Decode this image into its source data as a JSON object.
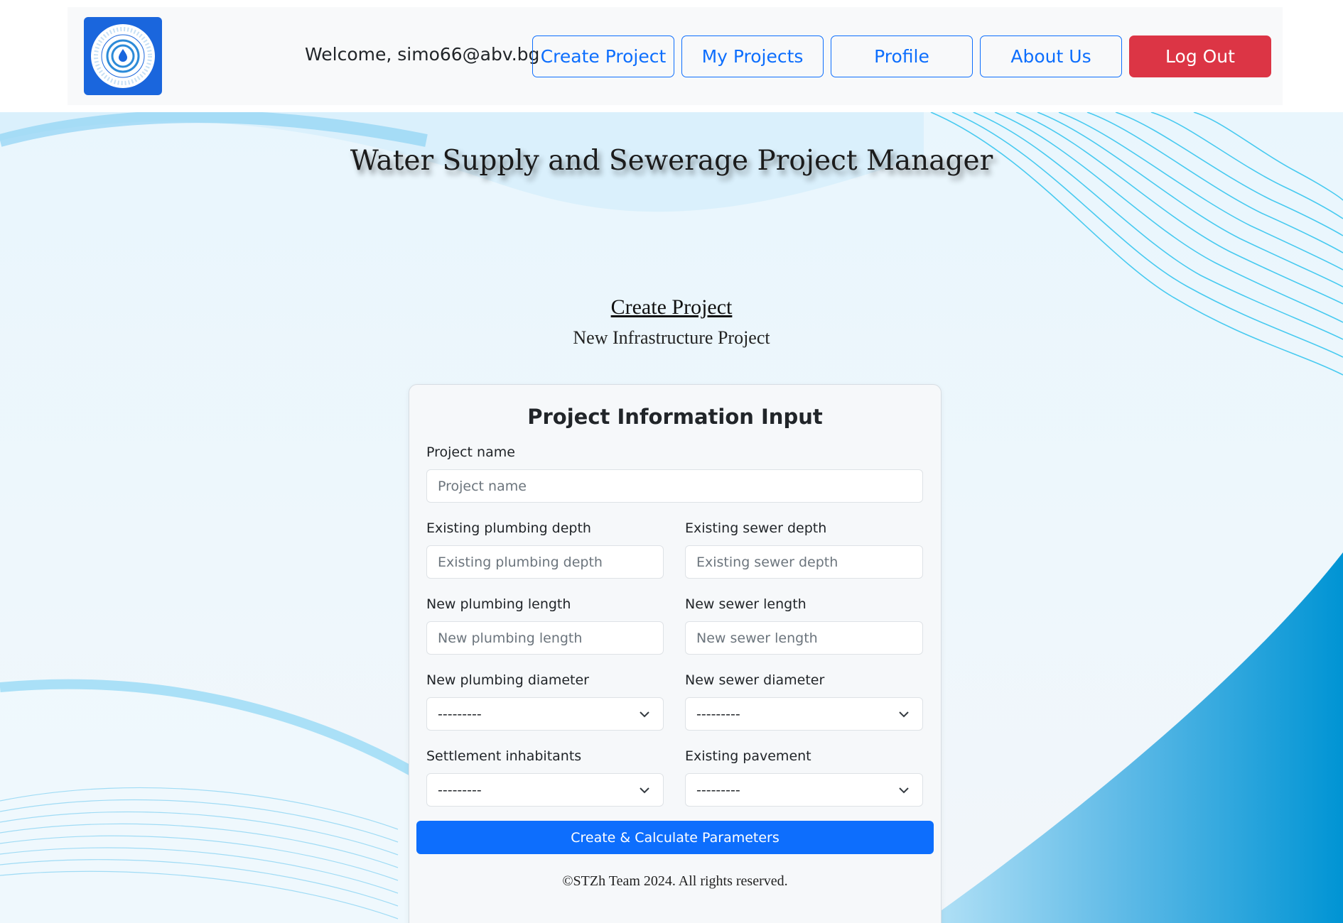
{
  "header": {
    "logo_text": "Water supply and sewerage project manager",
    "welcome": "Welcome, simo66@abv.bg",
    "nav": [
      {
        "label": "Create Project"
      },
      {
        "label": "My Projects"
      },
      {
        "label": "Profile"
      },
      {
        "label": "About Us"
      }
    ],
    "logout_label": "Log Out"
  },
  "site_title": "Water Supply and Sewerage Project Manager",
  "section": {
    "title": "Create Project",
    "subtitle": "New Infrastructure Project"
  },
  "form": {
    "title": "Project Information Input",
    "project_name": {
      "label": "Project name",
      "placeholder": "Project name"
    },
    "existing_plumbing_depth": {
      "label": "Existing plumbing depth",
      "placeholder": "Existing plumbing depth"
    },
    "existing_sewer_depth": {
      "label": "Existing sewer depth",
      "placeholder": "Existing sewer depth"
    },
    "new_plumbing_length": {
      "label": "New plumbing length",
      "placeholder": "New plumbing length"
    },
    "new_sewer_length": {
      "label": "New sewer length",
      "placeholder": "New sewer length"
    },
    "new_plumbing_diameter": {
      "label": "New plumbing diameter",
      "value": "---------"
    },
    "new_sewer_diameter": {
      "label": "New sewer diameter",
      "value": "---------"
    },
    "settlement_inhabitants": {
      "label": "Settlement inhabitants",
      "value": "---------"
    },
    "existing_pavement": {
      "label": "Existing pavement",
      "value": "---------"
    },
    "submit_label": "Create & Calculate Parameters"
  },
  "footer": {
    "copyright": "©STZh Team 2024. All rights reserved."
  },
  "colors": {
    "primary": "#0d6efd",
    "danger": "#dc3545",
    "logo_bg": "#1a66dd",
    "wave": "#0096d6"
  }
}
